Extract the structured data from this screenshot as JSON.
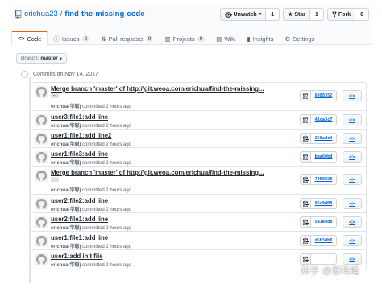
{
  "repo": {
    "owner": "erichua23",
    "separator": "/",
    "name": "find-the-missing-code"
  },
  "actions": {
    "watch_label": "Unwatch",
    "watch_count": "1",
    "star_label": "Star",
    "star_count": "1",
    "fork_label": "Fork",
    "fork_count": "0"
  },
  "tabs": [
    {
      "label": "Code"
    },
    {
      "label": "Issues",
      "count": "0"
    },
    {
      "label": "Pull requests",
      "count": "0"
    },
    {
      "label": "Projects",
      "count": "0"
    },
    {
      "label": "Wiki"
    },
    {
      "label": "Insights"
    },
    {
      "label": "Settings"
    }
  ],
  "branch": {
    "prefix": "Branch:",
    "name": "master"
  },
  "group": {
    "heading": "Commits on Nov 14, 2017"
  },
  "commits": [
    {
      "message": "Merge branch 'master' of http://git.weoa.com/erichua/find-the-missing...",
      "author": "erichua(华聪)",
      "time": "committed 2 hours ago",
      "sha": "6988352",
      "expand": "..."
    },
    {
      "message": "user3:file1:add line",
      "author": "erichua(华聪)",
      "time": "committed 2 hours ago",
      "sha": "41ca3c7"
    },
    {
      "message": "user1:file1:add line2",
      "author": "erichua(华聪)",
      "time": "committed 2 hours ago",
      "sha": "258adc4"
    },
    {
      "message": "user1:file3:add line",
      "author": "erichua(华聪)",
      "time": "committed 2 hours ago",
      "sha": "baa60bd"
    },
    {
      "message": "Merge branch 'master' of http://git.weoa.com/erichua/find-the-missing...",
      "author": "erichua(华聪)",
      "time": "committed 2 hours ago",
      "sha": "7059920",
      "expand": "..."
    },
    {
      "message": "user2:file2:add line",
      "author": "erichua(华聪)",
      "time": "committed 2 hours ago",
      "sha": "86c9d08"
    },
    {
      "message": "user2:file1:add line",
      "author": "erichua(华聪)",
      "time": "committed 2 hours ago",
      "sha": "5a1e8db"
    },
    {
      "message": "user1:file1:add line",
      "author": "erichua(华聪)",
      "time": "committed 2 hours ago",
      "sha": "d5b3db8"
    },
    {
      "message": "user1:add init file",
      "author": "erichua(华聪)",
      "time": "committed 2 hours ago",
      "sha": "",
      "browse": "<>"
    }
  ],
  "browse_label": "<>",
  "watermark": "知乎 @葱鸣锤"
}
